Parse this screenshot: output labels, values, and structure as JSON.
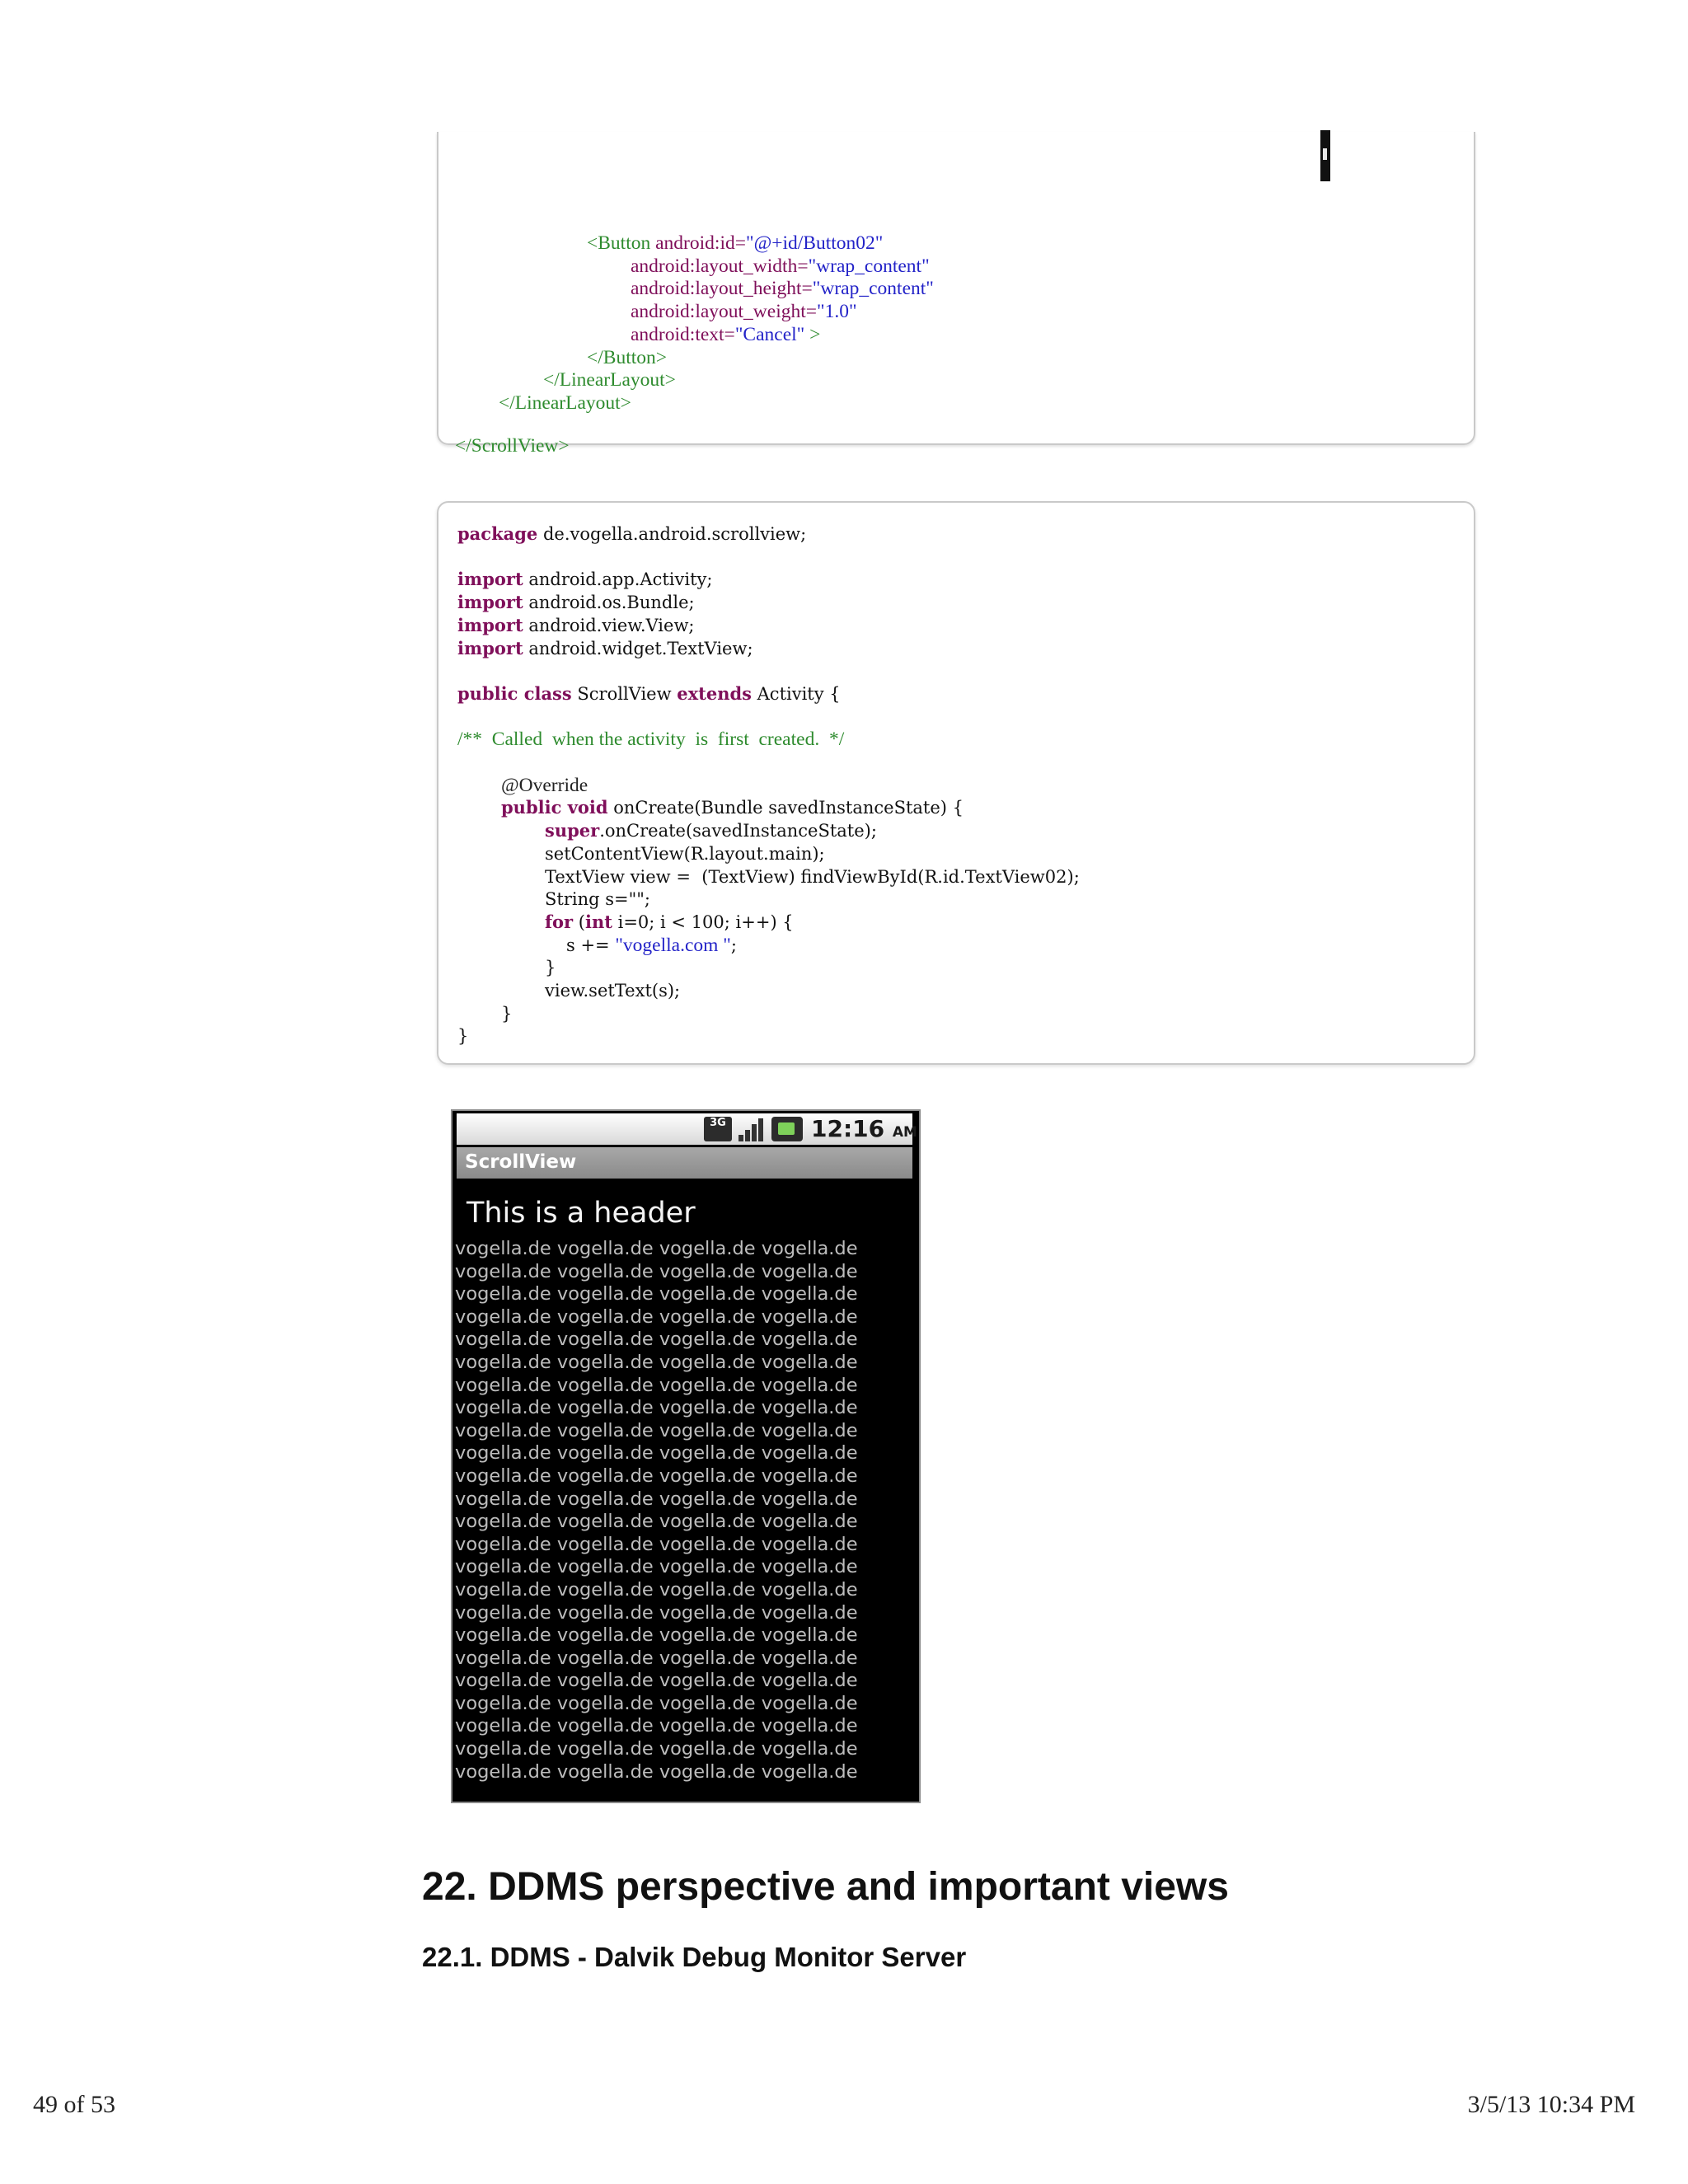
{
  "xml_code": {
    "lines": [
      {
        "indent": 160,
        "parts": [
          {
            "t": "tag",
            "v": "<Button "
          },
          {
            "t": "attr",
            "v": "android:id="
          },
          {
            "t": "val",
            "v": "\"@+id/Button02\""
          }
        ]
      },
      {
        "indent": 213,
        "parts": [
          {
            "t": "attr",
            "v": "android:layout_width="
          },
          {
            "t": "val",
            "v": "\"wrap_content\""
          }
        ]
      },
      {
        "indent": 213,
        "parts": [
          {
            "t": "attr",
            "v": "android:layout_height="
          },
          {
            "t": "val",
            "v": "\"wrap_content\""
          }
        ]
      },
      {
        "indent": 213,
        "parts": [
          {
            "t": "attr",
            "v": "android:layout_weight="
          },
          {
            "t": "val",
            "v": "\"1.0\""
          }
        ]
      },
      {
        "indent": 213,
        "parts": [
          {
            "t": "attr",
            "v": "android:text="
          },
          {
            "t": "val",
            "v": "\"Cancel\""
          },
          {
            "t": "tag",
            "v": " >"
          }
        ]
      },
      {
        "indent": 160,
        "parts": [
          {
            "t": "tag",
            "v": "</Button>"
          }
        ]
      },
      {
        "indent": 107,
        "parts": [
          {
            "t": "tag",
            "v": "</LinearLayout>"
          }
        ]
      },
      {
        "indent": 53,
        "parts": [
          {
            "t": "tag",
            "v": "</LinearLayout>"
          }
        ]
      }
    ],
    "closing": "</ScrollView>"
  },
  "java_code": {
    "lines": [
      {
        "indent": 0,
        "parts": [
          {
            "t": "kw",
            "v": "package"
          },
          {
            "t": "pl",
            "v": " de.vogella.android.scrollview;"
          }
        ]
      },
      {
        "indent": 0,
        "parts": []
      },
      {
        "indent": 0,
        "parts": [
          {
            "t": "kw",
            "v": "import"
          },
          {
            "t": "pl",
            "v": " android.app.Activity;"
          }
        ]
      },
      {
        "indent": 0,
        "parts": [
          {
            "t": "kw",
            "v": "import"
          },
          {
            "t": "pl",
            "v": " android.os.Bundle;"
          }
        ]
      },
      {
        "indent": 0,
        "parts": [
          {
            "t": "kw",
            "v": "import"
          },
          {
            "t": "pl",
            "v": " android.view.View;"
          }
        ]
      },
      {
        "indent": 0,
        "parts": [
          {
            "t": "kw",
            "v": "import"
          },
          {
            "t": "pl",
            "v": " android.widget.TextView;"
          }
        ]
      },
      {
        "indent": 0,
        "parts": []
      },
      {
        "indent": 0,
        "parts": [
          {
            "t": "kw",
            "v": "public class"
          },
          {
            "t": "pl",
            "v": " ScrollView "
          },
          {
            "t": "kw",
            "v": "extends"
          },
          {
            "t": "pl",
            "v": " Activity {"
          }
        ]
      },
      {
        "indent": 0,
        "parts": []
      },
      {
        "indent": 0,
        "parts": [
          {
            "t": "cm",
            "v": "/**  Called  when the activity  is  first  created.  */"
          }
        ]
      },
      {
        "indent": 0,
        "parts": []
      },
      {
        "indent": 53,
        "parts": [
          {
            "t": "ann",
            "v": "@Override"
          }
        ]
      },
      {
        "indent": 53,
        "parts": [
          {
            "t": "kw",
            "v": "public void"
          },
          {
            "t": "pl",
            "v": " onCreate(Bundle savedInstanceState) {"
          }
        ]
      },
      {
        "indent": 106,
        "parts": [
          {
            "t": "kw",
            "v": "super"
          },
          {
            "t": "pl",
            "v": ".onCreate(savedInstanceState);"
          }
        ]
      },
      {
        "indent": 106,
        "parts": [
          {
            "t": "pl",
            "v": "setContentView(R.layout.main);"
          }
        ]
      },
      {
        "indent": 106,
        "parts": [
          {
            "t": "pl",
            "v": "TextView view =  (TextView) findViewById(R.id.TextView02);"
          }
        ]
      },
      {
        "indent": 106,
        "parts": [
          {
            "t": "pl",
            "v": "String s=\"\";"
          }
        ]
      },
      {
        "indent": 106,
        "parts": [
          {
            "t": "kw",
            "v": "for"
          },
          {
            "t": "pl",
            "v": " ("
          },
          {
            "t": "kw",
            "v": "int"
          },
          {
            "t": "pl",
            "v": " i=0; i < 100; i++) {"
          }
        ]
      },
      {
        "indent": 132,
        "parts": [
          {
            "t": "pl",
            "v": "s += "
          },
          {
            "t": "str",
            "v": "\"vogella.com \""
          },
          {
            "t": "pl",
            "v": ";"
          }
        ]
      },
      {
        "indent": 106,
        "parts": [
          {
            "t": "pl",
            "v": "}"
          }
        ]
      },
      {
        "indent": 106,
        "parts": [
          {
            "t": "pl",
            "v": "view.setText(s);"
          }
        ]
      },
      {
        "indent": 53,
        "parts": [
          {
            "t": "pl",
            "v": "}"
          }
        ]
      },
      {
        "indent": 0,
        "parts": [
          {
            "t": "pl",
            "v": "}"
          }
        ]
      }
    ]
  },
  "phone": {
    "status_3g": "3G",
    "time": "12:16",
    "time_suffix": "AM",
    "app_title": "ScrollView",
    "header": "This is a header",
    "body_line": "vogella.de vogella.de vogella.de vogella.de",
    "body_line_count": 24
  },
  "section": {
    "heading": "22. DDMS perspective and important views",
    "subheading": "22.1. DDMS - Dalvik Debug Monitor Server"
  },
  "footer": {
    "page": "49 of 53",
    "datetime": "3/5/13 10:34 PM"
  }
}
